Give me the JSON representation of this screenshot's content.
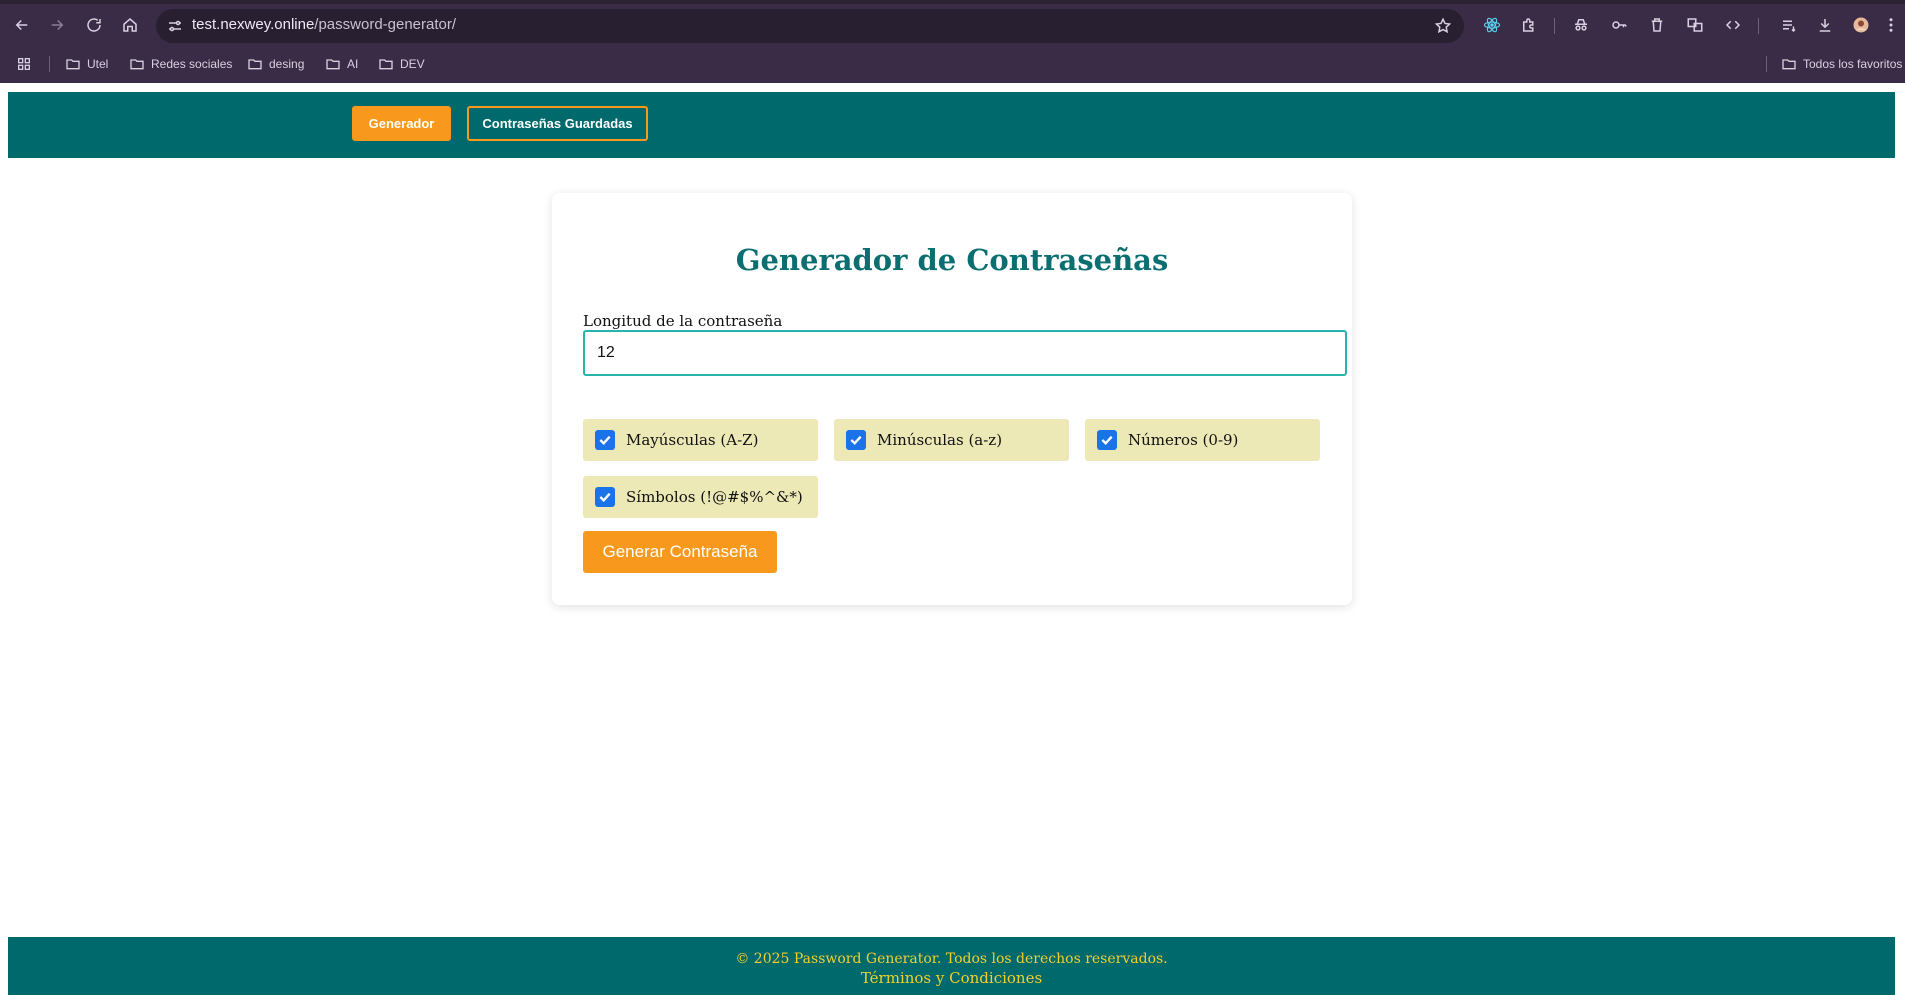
{
  "browser": {
    "url_host": "test.nexwey.online",
    "url_path": "/password-generator/",
    "bookmarks": [
      "Utel",
      "Redes sociales",
      "desing",
      "AI",
      "DEV"
    ],
    "all_bookmarks_label": "Todos los favoritos"
  },
  "nav": {
    "generator_label": "Generador",
    "saved_label": "Contraseñas Guardadas",
    "accent_color": "#f8991d",
    "bar_color": "#00696b"
  },
  "card": {
    "title": "Generador de Contraseñas",
    "length_label": "Longitud de la contraseña",
    "length_value": "12",
    "options": [
      {
        "label": "Mayúsculas (A-Z)",
        "checked": true
      },
      {
        "label": "Minúsculas (a-z)",
        "checked": true
      },
      {
        "label": "Números (0-9)",
        "checked": true
      },
      {
        "label": "Símbolos (!@#$%^&*)",
        "checked": true
      }
    ],
    "generate_label": "Generar Contraseña"
  },
  "footer": {
    "copyright": "© 2025 Password Generator. Todos los derechos reservados.",
    "terms": "Términos y Condiciones"
  }
}
